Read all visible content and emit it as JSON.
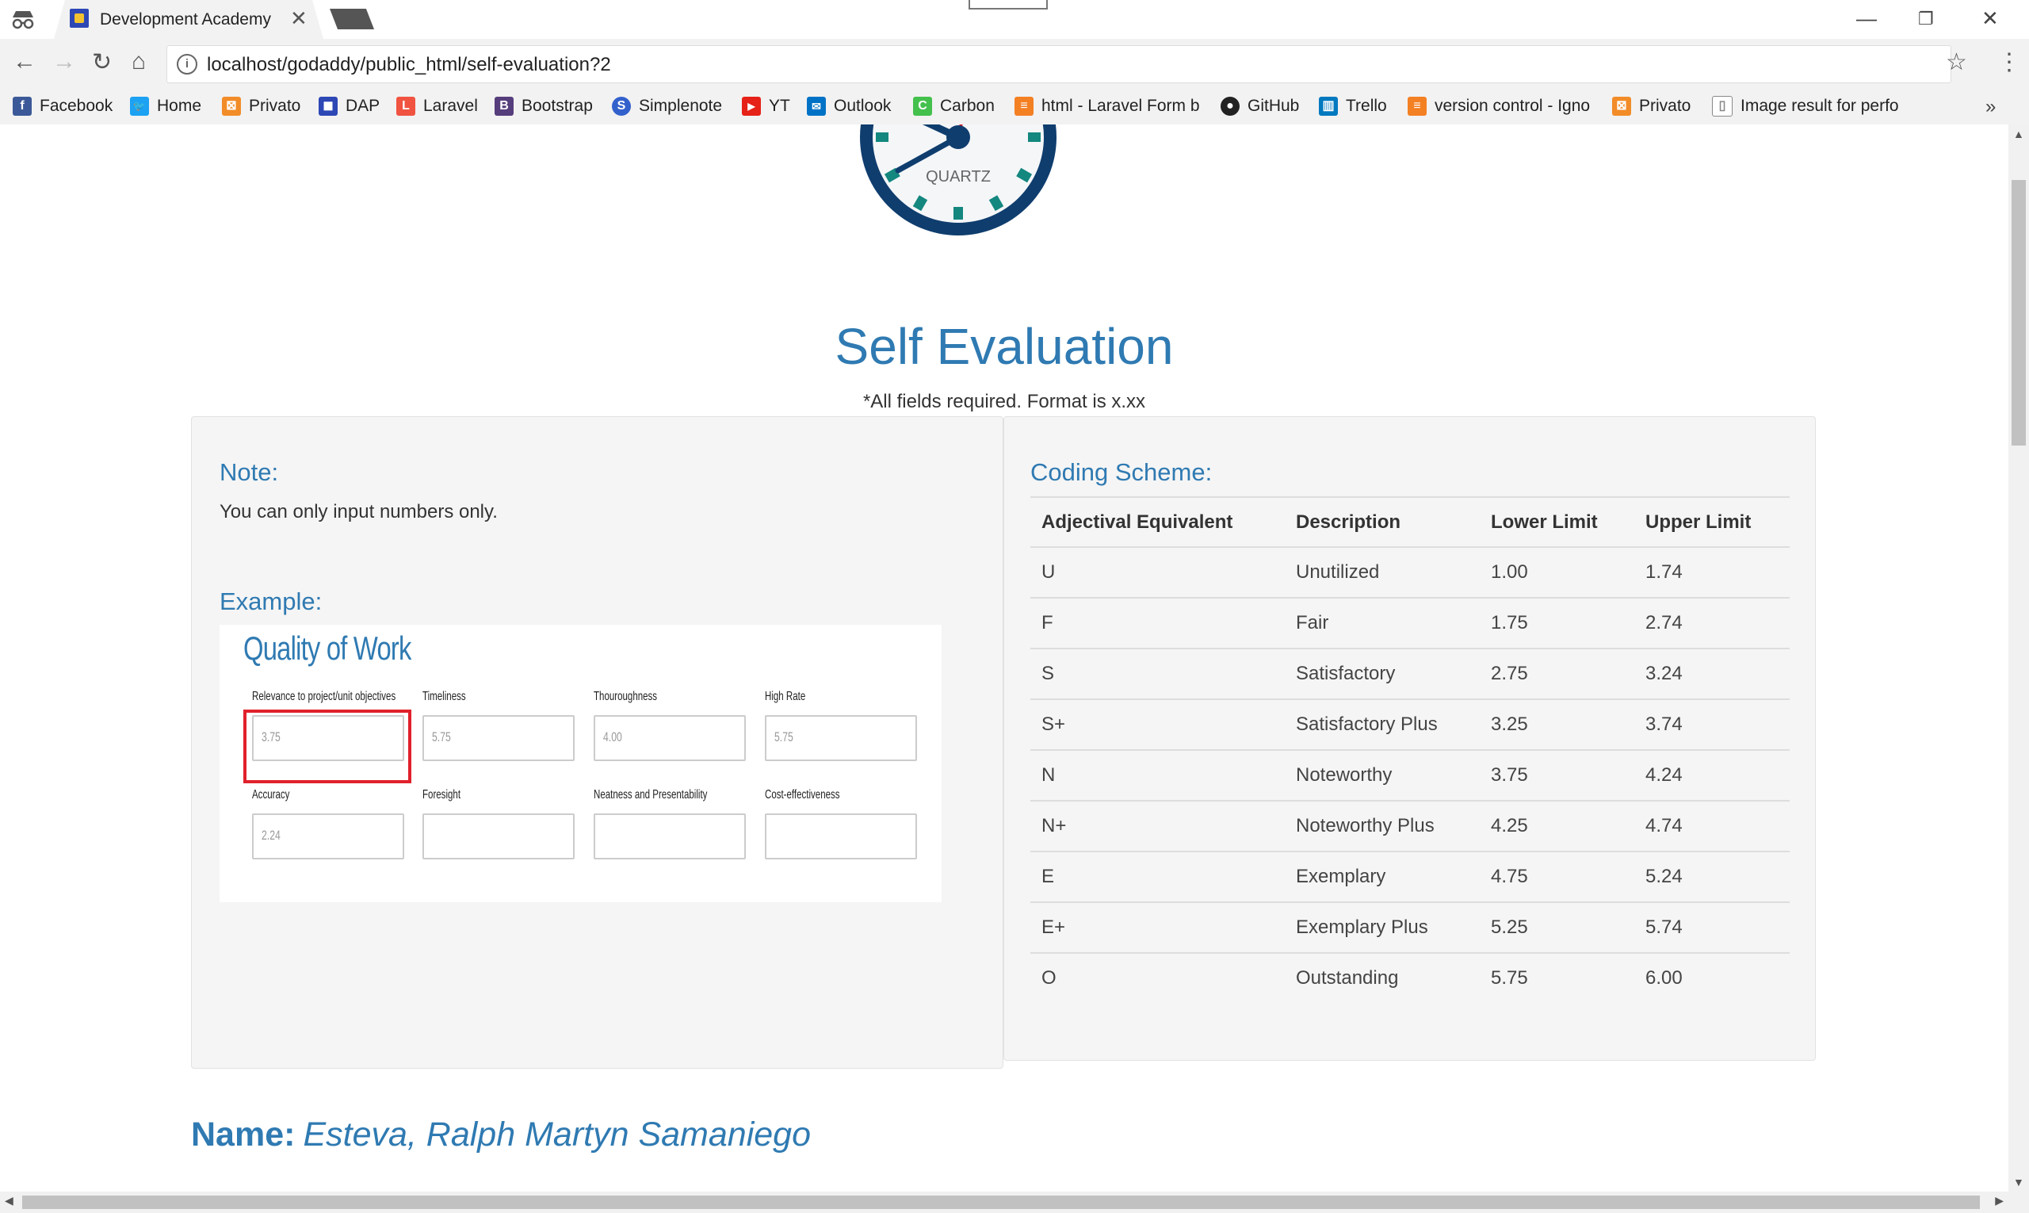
{
  "browser": {
    "tab_title": "Development Academy of the Philippines",
    "url": "localhost/godaddy/public_html/self-evaluation?2",
    "controls": {
      "minimize": "—",
      "restore": "❐",
      "close": "✕",
      "back": "←",
      "forward": "→",
      "reload": "↻",
      "home": "⌂",
      "star": "☆",
      "menu": "⋮",
      "tab_close": "✕",
      "info": "i",
      "more": "»"
    },
    "bookmarks": [
      {
        "label": "Facebook",
        "icon": "facebook-icon",
        "color": "#3b5998",
        "glyph": "f"
      },
      {
        "label": "Home",
        "icon": "twitter-icon",
        "color": "#1da1f2",
        "glyph": "🐦"
      },
      {
        "label": "Privato",
        "icon": "privato-icon",
        "color": "#f28c28",
        "glyph": "⊠"
      },
      {
        "label": "DAP",
        "icon": "dap-icon",
        "color": "#2d47b5",
        "glyph": "◼"
      },
      {
        "label": "Laravel",
        "icon": "laravel-icon",
        "color": "#f05340",
        "glyph": "L"
      },
      {
        "label": "Bootstrap",
        "icon": "bootstrap-icon",
        "color": "#563d7c",
        "glyph": "B"
      },
      {
        "label": "Simplenote",
        "icon": "simplenote-icon",
        "color": "#3361cc",
        "glyph": "S"
      },
      {
        "label": "YT",
        "icon": "youtube-icon",
        "color": "#e62117",
        "glyph": "▶"
      },
      {
        "label": "Outlook",
        "icon": "outlook-icon",
        "color": "#0072c6",
        "glyph": "✉"
      },
      {
        "label": "Carbon",
        "icon": "carbon-icon",
        "color": "#44c04d",
        "glyph": "C"
      },
      {
        "label": "html - Laravel Form b",
        "icon": "stackoverflow-icon",
        "color": "#f48024",
        "glyph": "≡"
      },
      {
        "label": "GitHub",
        "icon": "github-icon",
        "color": "#222222",
        "glyph": "●"
      },
      {
        "label": "Trello",
        "icon": "trello-icon",
        "color": "#0079bf",
        "glyph": "▥"
      },
      {
        "label": "version control - Igno",
        "icon": "stackoverflow-icon",
        "color": "#f48024",
        "glyph": "≡"
      },
      {
        "label": "Privato",
        "icon": "privato-icon",
        "color": "#f28c28",
        "glyph": "⊠"
      },
      {
        "label": "Image result for perfo",
        "icon": "page-icon",
        "color": "#888888",
        "glyph": "▯"
      }
    ]
  },
  "page": {
    "clock_label": "QUARTZ",
    "title": "Self Evaluation",
    "required_note": "*All fields required. Format is x.xx",
    "note": {
      "heading": "Note:",
      "text": "You can only input numbers only."
    },
    "example": {
      "heading": "Example:",
      "card_title": "Quality of Work",
      "fields": [
        {
          "label": "Relevance to project/unit objectives",
          "value": "3.75"
        },
        {
          "label": "Timeliness",
          "value": "5.75"
        },
        {
          "label": "Thouroughness",
          "value": "4.00"
        },
        {
          "label": "High Rate",
          "value": "5.75"
        },
        {
          "label": "Accuracy",
          "value": "2.24"
        },
        {
          "label": "Foresight",
          "value": ""
        },
        {
          "label": "Neatness and Presentability",
          "value": ""
        },
        {
          "label": "Cost-effectiveness",
          "value": ""
        }
      ]
    },
    "coding_scheme": {
      "heading": "Coding Scheme:",
      "columns": [
        "Adjectival Equivalent",
        "Description",
        "Lower Limit",
        "Upper Limit"
      ],
      "rows": [
        [
          "U",
          "Unutilized",
          "1.00",
          "1.74"
        ],
        [
          "F",
          "Fair",
          "1.75",
          "2.74"
        ],
        [
          "S",
          "Satisfactory",
          "2.75",
          "3.24"
        ],
        [
          "S+",
          "Satisfactory Plus",
          "3.25",
          "3.74"
        ],
        [
          "N",
          "Noteworthy",
          "3.75",
          "4.24"
        ],
        [
          "N+",
          "Noteworthy Plus",
          "4.25",
          "4.74"
        ],
        [
          "E",
          "Exemplary",
          "4.75",
          "5.24"
        ],
        [
          "E+",
          "Exemplary Plus",
          "5.25",
          "5.74"
        ],
        [
          "O",
          "Outstanding",
          "5.75",
          "6.00"
        ]
      ]
    },
    "name_label": "Name:",
    "name_value": "Esteva, Ralph Martyn Samaniego"
  },
  "colors": {
    "accent": "#2f7ab2",
    "highlight": "#e0212b",
    "clock_ring": "#0f3d6e",
    "clock_marks": "#14877f"
  }
}
